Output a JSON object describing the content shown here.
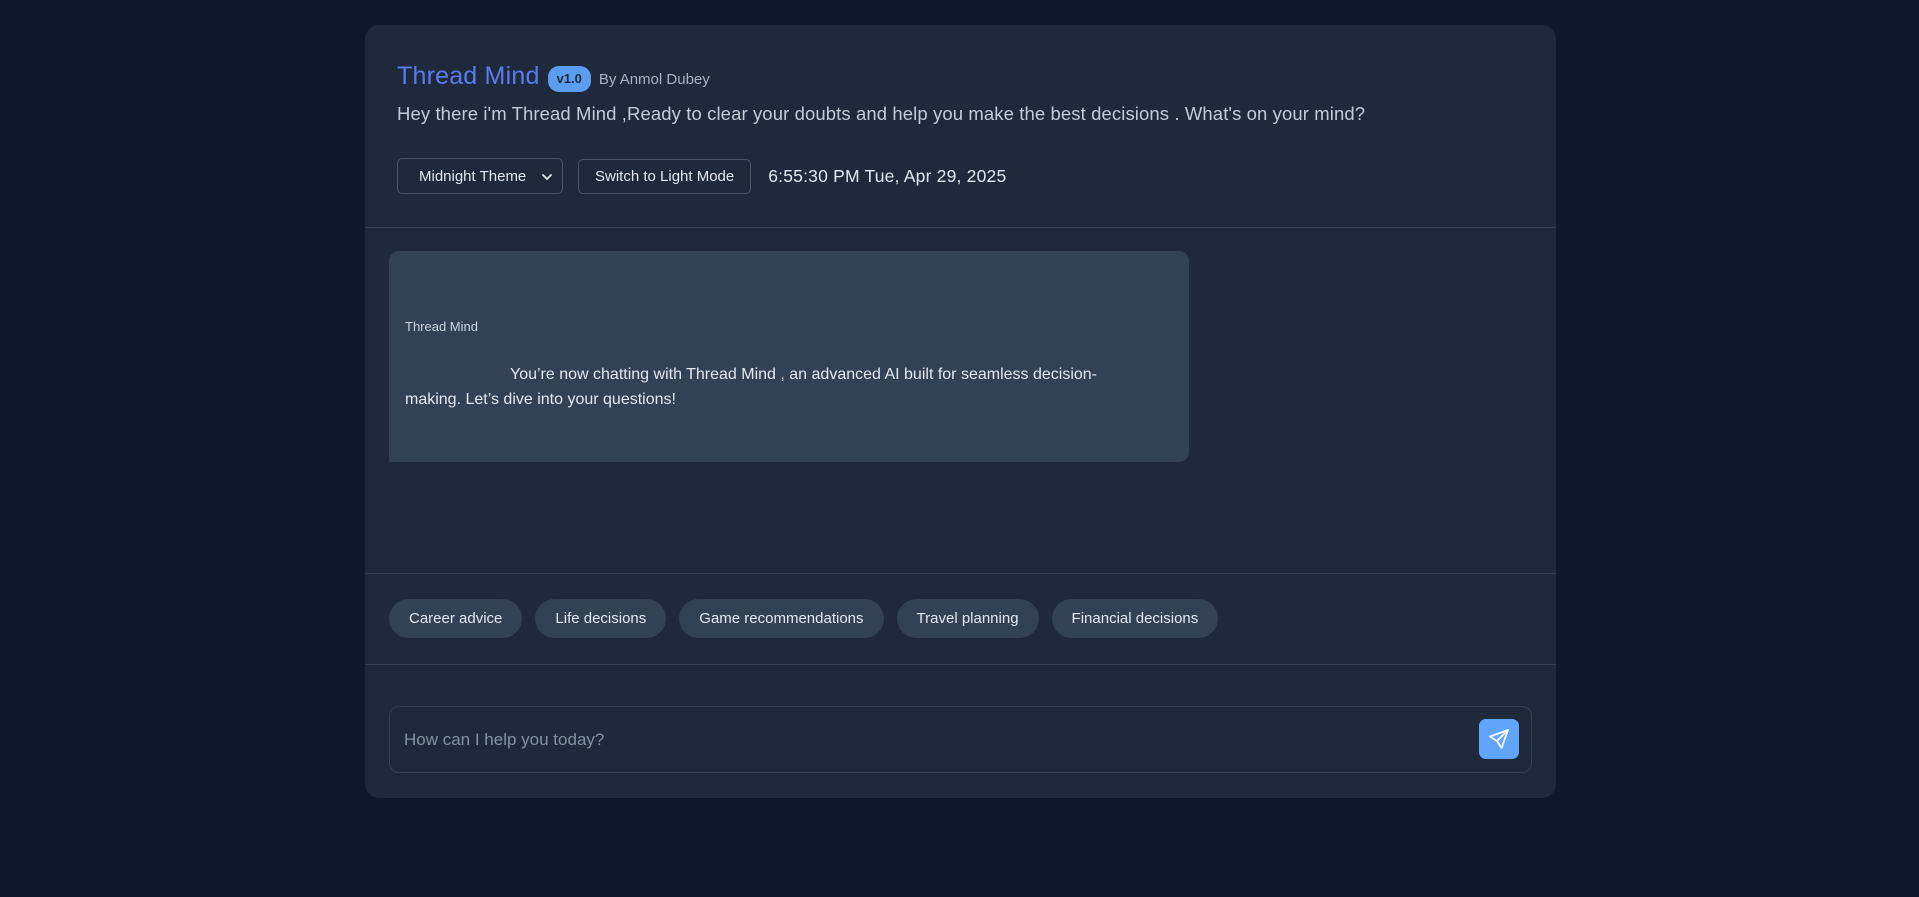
{
  "header": {
    "title": "Thread Mind",
    "version": "v1.0",
    "author": "By Anmol Dubey",
    "tagline": "Hey there i'm Thread Mind ,Ready to clear your doubts and help you make the best decisions . What's on your mind?",
    "theme_select": "Midnight Theme",
    "light_mode_button": "Switch to Light Mode",
    "datetime": "6:55:30 PM Tue, Apr 29, 2025"
  },
  "chat": {
    "messages": [
      {
        "sender": "Thread Mind",
        "text": "You’re now chatting with Thread Mind , an advanced AI built for seamless decision-making. Let’s dive into your questions!"
      }
    ]
  },
  "suggestions": [
    "Career advice",
    "Life decisions",
    "Game recommendations",
    "Travel planning",
    "Financial decisions"
  ],
  "input": {
    "placeholder": "How can I help you today?",
    "value": ""
  },
  "icons": {
    "send": "send-icon",
    "chevron": "chevron-down-icon"
  },
  "colors": {
    "background": "#0f172a",
    "card": "#1e293b",
    "bubble": "#334155",
    "accent_title": "#5b7cf0",
    "accent_button": "#60a5fa"
  }
}
